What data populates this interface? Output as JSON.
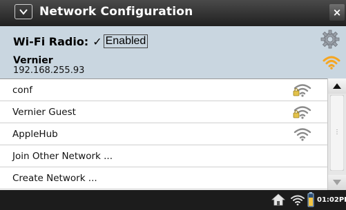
{
  "window": {
    "title": "Network Configuration",
    "close_label": "×"
  },
  "header": {
    "wifi_radio_label": "Wi-Fi Radio:",
    "wifi_check": "✓",
    "wifi_enabled_label": "Enabled",
    "connected_network_name": "Vernier",
    "connected_ip": "192.168.255.93"
  },
  "networks": [
    {
      "name": "conf",
      "secured": true,
      "icon": "wifi-lock-icon"
    },
    {
      "name": "Vernier Guest",
      "secured": true,
      "icon": "wifi-lock-icon"
    },
    {
      "name": "AppleHub",
      "secured": false,
      "icon": "wifi-icon"
    },
    {
      "name": "Join Other Network ..."
    },
    {
      "name": "Create Network ..."
    }
  ],
  "statusbar": {
    "time": "01:02PI"
  },
  "colors": {
    "header_bg": "#c9d6e0",
    "titlebar_bg": "#202020",
    "accent_orange": "#f5a623"
  }
}
